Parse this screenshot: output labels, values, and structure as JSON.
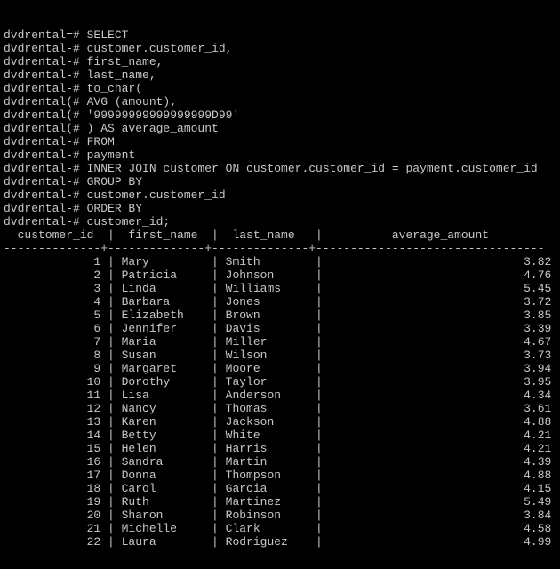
{
  "prompt": "dvdrental",
  "sql_lines": [
    {
      "mark": "=#",
      "text": "SELECT"
    },
    {
      "mark": "-#",
      "text": "customer.customer_id,"
    },
    {
      "mark": "-#",
      "text": "first_name,"
    },
    {
      "mark": "-#",
      "text": "last_name,"
    },
    {
      "mark": "-#",
      "text": "to_char("
    },
    {
      "mark": "(#",
      "text": "AVG (amount),"
    },
    {
      "mark": "(#",
      "text": "'99999999999999999D99'"
    },
    {
      "mark": "(#",
      "text": ") AS average_amount"
    },
    {
      "mark": "-#",
      "text": "FROM"
    },
    {
      "mark": "-#",
      "text": "payment"
    },
    {
      "mark": "-#",
      "text": "INNER JOIN customer ON customer.customer_id = payment.customer_id"
    },
    {
      "mark": "-#",
      "text": "GROUP BY"
    },
    {
      "mark": "-#",
      "text": "customer.customer_id"
    },
    {
      "mark": "-#",
      "text": "ORDER BY"
    },
    {
      "mark": "-#",
      "text": "customer_id;"
    }
  ],
  "columns": [
    {
      "name": "customer_id",
      "width": 13,
      "align": "right"
    },
    {
      "name": "first_name",
      "width": 12,
      "align": "left"
    },
    {
      "name": "last_name",
      "width": 12,
      "align": "left"
    },
    {
      "name": "average_amount",
      "width": 32,
      "align": "right"
    }
  ],
  "rows": [
    {
      "customer_id": "1",
      "first_name": "Mary",
      "last_name": "Smith",
      "average_amount": "3.82"
    },
    {
      "customer_id": "2",
      "first_name": "Patricia",
      "last_name": "Johnson",
      "average_amount": "4.76"
    },
    {
      "customer_id": "3",
      "first_name": "Linda",
      "last_name": "Williams",
      "average_amount": "5.45"
    },
    {
      "customer_id": "4",
      "first_name": "Barbara",
      "last_name": "Jones",
      "average_amount": "3.72"
    },
    {
      "customer_id": "5",
      "first_name": "Elizabeth",
      "last_name": "Brown",
      "average_amount": "3.85"
    },
    {
      "customer_id": "6",
      "first_name": "Jennifer",
      "last_name": "Davis",
      "average_amount": "3.39"
    },
    {
      "customer_id": "7",
      "first_name": "Maria",
      "last_name": "Miller",
      "average_amount": "4.67"
    },
    {
      "customer_id": "8",
      "first_name": "Susan",
      "last_name": "Wilson",
      "average_amount": "3.73"
    },
    {
      "customer_id": "9",
      "first_name": "Margaret",
      "last_name": "Moore",
      "average_amount": "3.94"
    },
    {
      "customer_id": "10",
      "first_name": "Dorothy",
      "last_name": "Taylor",
      "average_amount": "3.95"
    },
    {
      "customer_id": "11",
      "first_name": "Lisa",
      "last_name": "Anderson",
      "average_amount": "4.34"
    },
    {
      "customer_id": "12",
      "first_name": "Nancy",
      "last_name": "Thomas",
      "average_amount": "3.61"
    },
    {
      "customer_id": "13",
      "first_name": "Karen",
      "last_name": "Jackson",
      "average_amount": "4.88"
    },
    {
      "customer_id": "14",
      "first_name": "Betty",
      "last_name": "White",
      "average_amount": "4.21"
    },
    {
      "customer_id": "15",
      "first_name": "Helen",
      "last_name": "Harris",
      "average_amount": "4.21"
    },
    {
      "customer_id": "16",
      "first_name": "Sandra",
      "last_name": "Martin",
      "average_amount": "4.39"
    },
    {
      "customer_id": "17",
      "first_name": "Donna",
      "last_name": "Thompson",
      "average_amount": "4.88"
    },
    {
      "customer_id": "18",
      "first_name": "Carol",
      "last_name": "Garcia",
      "average_amount": "4.15"
    },
    {
      "customer_id": "19",
      "first_name": "Ruth",
      "last_name": "Martinez",
      "average_amount": "5.49"
    },
    {
      "customer_id": "20",
      "first_name": "Sharon",
      "last_name": "Robinson",
      "average_amount": "3.84"
    },
    {
      "customer_id": "21",
      "first_name": "Michelle",
      "last_name": "Clark",
      "average_amount": "4.58"
    },
    {
      "customer_id": "22",
      "first_name": "Laura",
      "last_name": "Rodriguez",
      "average_amount": "4.99"
    }
  ]
}
